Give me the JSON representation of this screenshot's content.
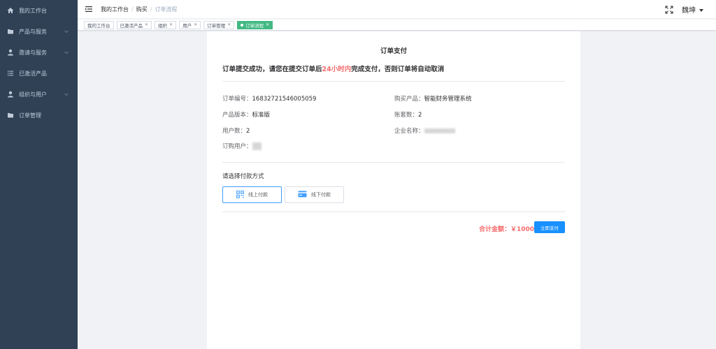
{
  "sidebar": {
    "items": [
      {
        "label": "我的工作台",
        "icon": "home-icon",
        "has_arrow": false
      },
      {
        "label": "产品与服务",
        "icon": "folder-icon",
        "has_arrow": true
      },
      {
        "label": "邀请与服务",
        "icon": "user-icon",
        "has_arrow": true
      },
      {
        "label": "已激活产品",
        "icon": "list-icon",
        "has_arrow": false
      },
      {
        "label": "组织与用户",
        "icon": "user-icon",
        "has_arrow": true
      },
      {
        "label": "订单管理",
        "icon": "folder-icon",
        "has_arrow": false
      }
    ]
  },
  "header": {
    "breadcrumb": [
      "我的工作台",
      "购买",
      "订单流程"
    ],
    "username": "魏坤"
  },
  "tags": [
    {
      "label": "我的工作台",
      "closable": false,
      "active": false
    },
    {
      "label": "已激活产品",
      "closable": true,
      "active": false
    },
    {
      "label": "组织",
      "closable": true,
      "active": false
    },
    {
      "label": "用户",
      "closable": true,
      "active": false
    },
    {
      "label": "订单管理",
      "closable": true,
      "active": false
    },
    {
      "label": "订单流程",
      "closable": true,
      "active": true
    }
  ],
  "order": {
    "title": "订单支付",
    "notice_prefix": "订单提交成功，请您在提交订单后",
    "notice_highlight": "24小时内",
    "notice_suffix": "完成支付，否则订单将自动取消",
    "order_no_label": "订单编号：",
    "order_no": "16832721546005059",
    "product_label": "购买产品：",
    "product": "智能财务管理系统",
    "version_label": "产品版本：",
    "version": "标准版",
    "accounts_label": "账套数：",
    "accounts": "2",
    "users_label": "用户数：",
    "users": "2",
    "company_label": "企业名称：",
    "buyer_label": "订购用户："
  },
  "payment": {
    "label": "请选择付款方式",
    "online": "线上付款",
    "offline": "线下付款",
    "total": "合计金额：￥1000",
    "pay_now": "立即支付"
  },
  "colors": {
    "sidebar_bg": "#304156",
    "sidebar_text": "#bfcbd9",
    "active_tag": "#42b983",
    "highlight_red": "#f56c6c",
    "primary_blue": "#1890ff"
  }
}
